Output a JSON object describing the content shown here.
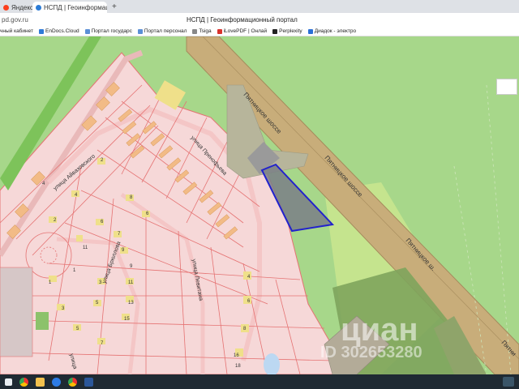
{
  "browser": {
    "tabs": [
      {
        "label": "Яндекс нал",
        "active": false
      },
      {
        "label": "НСПД | Геоинформац",
        "active": true
      }
    ],
    "new_tab_label": "+",
    "close_glyph": "×",
    "url": "pd.gov.ru",
    "page_title": "НСПД | Геоинформационный портал",
    "bookmarks": [
      {
        "label": "чный кабинет",
        "icon": "bookmark-icon",
        "color": "#888888"
      },
      {
        "label": "EnDocs.Cloud",
        "icon": "cloud-icon",
        "color": "#2f7ad8"
      },
      {
        "label": "Портал государс",
        "icon": "gov-icon",
        "color": "#5b8fd6"
      },
      {
        "label": "Портал персонал",
        "icon": "gov-icon",
        "color": "#5b8fd6"
      },
      {
        "label": "Tsiga",
        "icon": "bookmark-icon",
        "color": "#888888"
      },
      {
        "label": "iLovePDF | Онлай",
        "icon": "pdf-icon",
        "color": "#d8322d"
      },
      {
        "label": "Perplexity",
        "icon": "perplexity-icon",
        "color": "#222222"
      },
      {
        "label": "Диадок - электро",
        "icon": "diadoc-icon",
        "color": "#2b6fd6"
      }
    ]
  },
  "map": {
    "road_labels": {
      "highway_1": "Пятницкое шоссе",
      "highway_2": "Пятницкое шоссе",
      "highway_3": "Пятницкое ш.",
      "highway_4": "Пятни",
      "street_aivazovsky": "улица Айвазовского",
      "street_prenofieva": "улица Пренофьева",
      "street_bryullov": "улица Брюллова",
      "street_levitan": "улица Левитана",
      "street_bottom": "улица"
    },
    "house_numbers": [
      "4",
      "2",
      "6",
      "8",
      "1",
      "3",
      "5",
      "7",
      "9",
      "11",
      "13",
      "15",
      "1",
      "3",
      "5",
      "7",
      "9",
      "11",
      "2",
      "4",
      "6",
      "10",
      "12",
      "14",
      "16",
      "18",
      "16",
      "9",
      "7",
      "5",
      "4",
      "6",
      "8",
      "10",
      "12",
      "19",
      "20",
      "16"
    ],
    "watermark": "циан",
    "watermark_id": "ID 302653280",
    "colors": {
      "parcel_fill": "#f6d8d8",
      "parcel_line": "#e57373",
      "green": "#a7d78a",
      "road": "#c8ad7a",
      "selected_outline": "#2222cc",
      "selected_fill": "#7a7f86"
    }
  },
  "taskbar": {
    "icons": [
      "start-icon",
      "chrome-icon",
      "explorer-icon",
      "app-icon",
      "chrome-icon",
      "word-icon"
    ]
  }
}
